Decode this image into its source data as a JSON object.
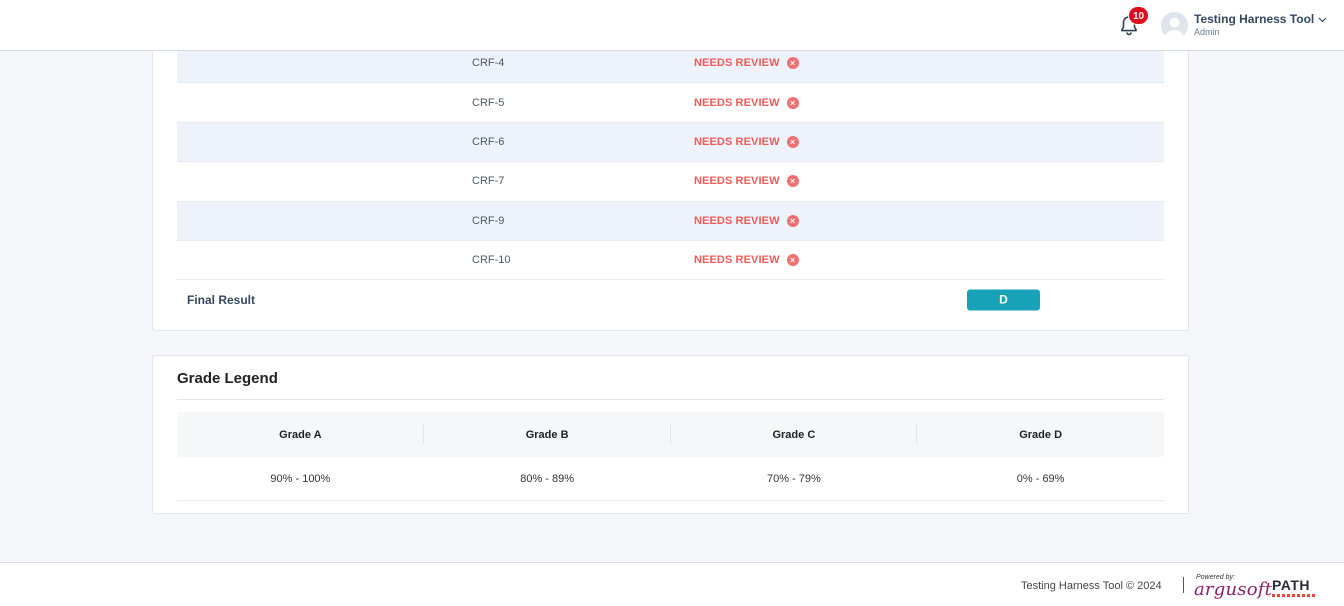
{
  "header": {
    "notification_count": "10",
    "user_name": "Testing Harness Tool",
    "user_role": "Admin"
  },
  "results_table": {
    "rows": [
      {
        "crf": "CRF-4",
        "status": "NEEDS REVIEW"
      },
      {
        "crf": "CRF-5",
        "status": "NEEDS REVIEW"
      },
      {
        "crf": "CRF-6",
        "status": "NEEDS REVIEW"
      },
      {
        "crf": "CRF-7",
        "status": "NEEDS REVIEW"
      },
      {
        "crf": "CRF-9",
        "status": "NEEDS REVIEW"
      },
      {
        "crf": "CRF-10",
        "status": "NEEDS REVIEW"
      }
    ],
    "final_result_label": "Final Result",
    "final_grade": "D"
  },
  "grade_legend": {
    "title": "Grade Legend",
    "headers": [
      "Grade A",
      "Grade B",
      "Grade C",
      "Grade D"
    ],
    "ranges": [
      "90% - 100%",
      "80% - 89%",
      "70% - 79%",
      "0% - 69%"
    ]
  },
  "footer": {
    "copyright": "Testing Harness Tool © 2024",
    "powered_by": "Powered by:",
    "company": "argusoft",
    "partner": "PATH"
  },
  "colors": {
    "needs_review": "#f05a5a",
    "grade_pill": "#17a2b8",
    "row_alt": "#eef3fb",
    "badge": "#e00b1c"
  }
}
